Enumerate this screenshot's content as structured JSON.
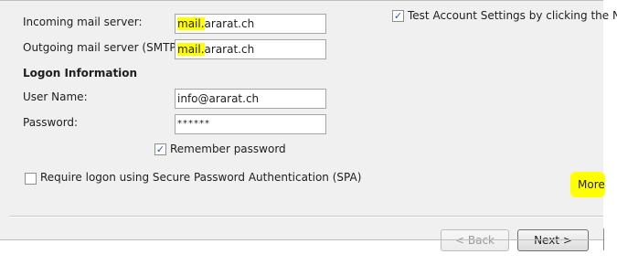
{
  "server": {
    "incoming_label": "Incoming mail server:",
    "incoming_prefix": "mail.",
    "incoming_rest": "ararat.ch",
    "outgoing_label": "Outgoing mail server (SMTP):",
    "outgoing_prefix": "mail.",
    "outgoing_rest": "ararat.ch"
  },
  "logon": {
    "heading": "Logon Information",
    "username_label": "User Name:",
    "username_value": "info@ararat.ch",
    "password_label": "Password:",
    "password_value": "******",
    "remember_label": "Remember password",
    "remember_checked": true,
    "spa_label": "Require logon using Secure Password Authentication (SPA)",
    "spa_checked": false
  },
  "test": {
    "label": "Test Account Settings by clicking the Ne",
    "checked": true
  },
  "buttons": {
    "more": "More",
    "back": "< Back",
    "next": "Next >"
  },
  "colors": {
    "highlight": "#ffff00",
    "panel": "#f0f0f0"
  }
}
